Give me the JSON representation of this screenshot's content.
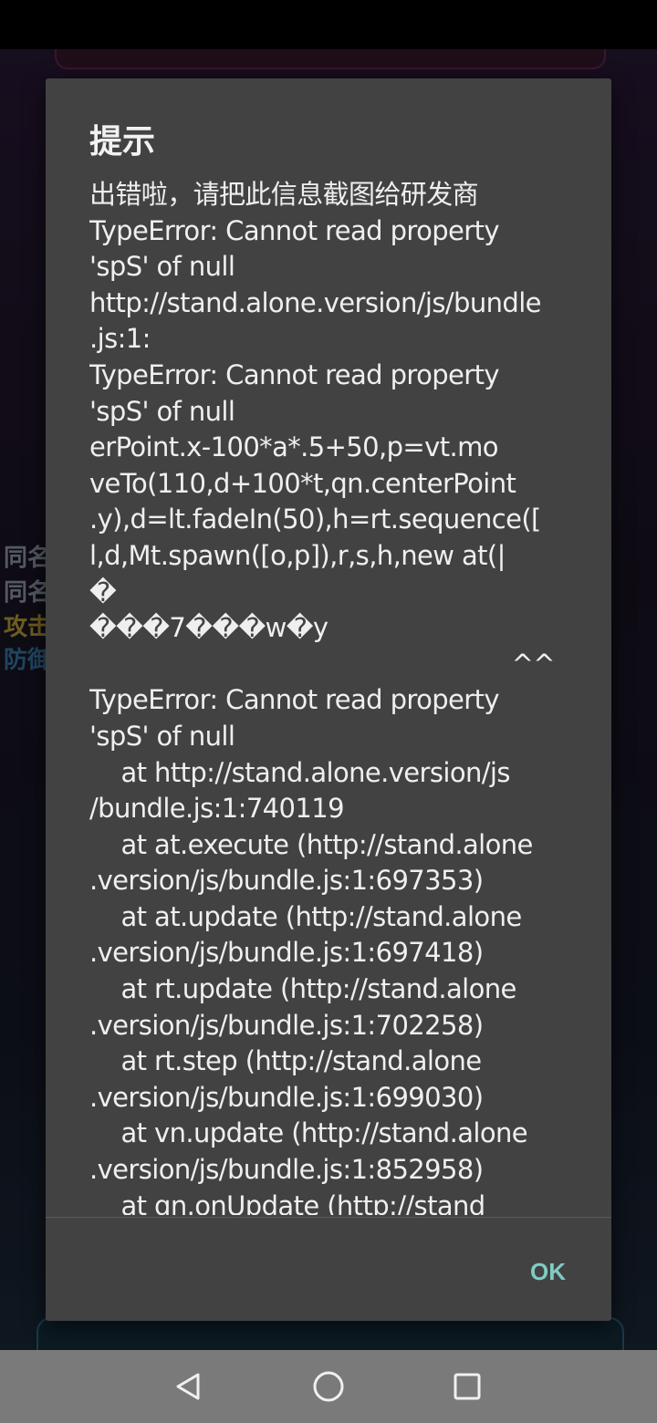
{
  "game_background": {
    "side_labels": [
      {
        "text": "同名",
        "color": "#9aa3b5"
      },
      {
        "text": "同名",
        "color": "#9aa3b5"
      },
      {
        "text": "攻击",
        "color": "#c8a93a"
      },
      {
        "text": "防御",
        "color": "#3d7fb0"
      }
    ]
  },
  "dialog": {
    "title": "提示",
    "message_lines": [
      "出错啦，请把此信息截图给研发商",
      "TypeError: Cannot read property",
      "'spS' of null",
      "http://stand.alone.version/js/bundle",
      ".js:1:",
      "TypeError: Cannot read property",
      "'spS' of null",
      "erPoint.x-100*a*.5+50,p=vt.mo",
      "veTo(110,d+100*t,qn.centerPoint",
      ".y),d=lt.fadeIn(50),h=rt.sequence([",
      "l,d,Mt.spawn([o,p]),r,s,h,new at(|",
      "�",
      "���7���w�y",
      "^^",
      "TypeError: Cannot read property",
      "'spS' of null",
      "    at http://stand.alone.version/js",
      "/bundle.js:1:740119",
      "    at at.execute (http://stand.alone",
      ".version/js/bundle.js:1:697353)",
      "    at at.update (http://stand.alone",
      ".version/js/bundle.js:1:697418)",
      "    at rt.update (http://stand.alone",
      ".version/js/bundle.js:1:702258)",
      "    at rt.step (http://stand.alone",
      ".version/js/bundle.js:1:699030)",
      "    at vn.update (http://stand.alone",
      ".version/js/bundle.js:1:852958)",
      "    at qn.onUpdate (http://stand"
    ],
    "ok_label": "OK"
  },
  "navigation": {
    "back_icon": "back-triangle-icon",
    "home_icon": "home-circle-icon",
    "recents_icon": "recents-square-icon"
  },
  "colors": {
    "dialog_bg": "#424242",
    "dialog_text": "#efefef",
    "ok_accent": "#80cbc4",
    "nav_bar": "#7a7a7a"
  }
}
